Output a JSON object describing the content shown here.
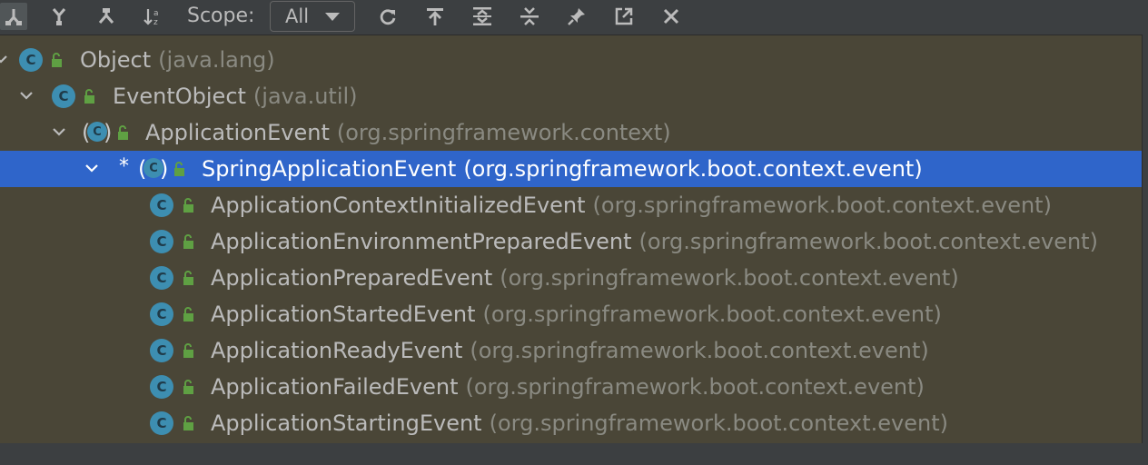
{
  "toolbar": {
    "buttons": [
      {
        "name": "subtypes-hierarchy-button",
        "icon": "subtypes-icon"
      },
      {
        "name": "supertypes-hierarchy-button",
        "icon": "supertypes-icon"
      },
      {
        "name": "class-hierarchy-button",
        "icon": "class-hierarchy-icon"
      },
      {
        "name": "sort-alphabetically-button",
        "icon": "sort-alpha-icon"
      }
    ],
    "scope_label": "Scope:",
    "scope_value": "All",
    "actions": [
      {
        "name": "refresh-button",
        "icon": "refresh-icon"
      },
      {
        "name": "scroll-to-source-button",
        "icon": "scroll-to-source-icon"
      },
      {
        "name": "expand-all-button",
        "icon": "expand-all-icon"
      },
      {
        "name": "collapse-all-button",
        "icon": "collapse-all-icon"
      },
      {
        "name": "pin-button",
        "icon": "pin-icon"
      },
      {
        "name": "open-in-new-window-button",
        "icon": "external-icon"
      },
      {
        "name": "close-button",
        "icon": "close-icon"
      }
    ]
  },
  "colors": {
    "background": "#4a4637",
    "selection": "#2f65ca",
    "class_icon": "#3d8eb1",
    "lock_green": "#5fa043",
    "text": "#bbbbbb",
    "package_text": "#8a8a82"
  },
  "tree": [
    {
      "name": "Object",
      "package": "(java.lang)",
      "expanded": true,
      "abstract": false,
      "selected": false
    },
    {
      "name": "EventObject",
      "package": "(java.util)",
      "expanded": true,
      "abstract": false,
      "selected": false
    },
    {
      "name": "ApplicationEvent",
      "package": "(org.springframework.context)",
      "expanded": true,
      "abstract": true,
      "selected": false
    },
    {
      "name": "SpringApplicationEvent",
      "package": "(org.springframework.boot.context.event)",
      "expanded": true,
      "abstract": true,
      "selected": true,
      "marker": "*"
    },
    {
      "name": "ApplicationContextInitializedEvent",
      "package": "(org.springframework.boot.context.event)",
      "abstract": false,
      "selected": false
    },
    {
      "name": "ApplicationEnvironmentPreparedEvent",
      "package": "(org.springframework.boot.context.event)",
      "abstract": false,
      "selected": false
    },
    {
      "name": "ApplicationPreparedEvent",
      "package": "(org.springframework.boot.context.event)",
      "abstract": false,
      "selected": false
    },
    {
      "name": "ApplicationStartedEvent",
      "package": "(org.springframework.boot.context.event)",
      "abstract": false,
      "selected": false
    },
    {
      "name": "ApplicationReadyEvent",
      "package": "(org.springframework.boot.context.event)",
      "abstract": false,
      "selected": false
    },
    {
      "name": "ApplicationFailedEvent",
      "package": "(org.springframework.boot.context.event)",
      "abstract": false,
      "selected": false
    },
    {
      "name": "ApplicationStartingEvent",
      "package": "(org.springframework.boot.context.event)",
      "abstract": false,
      "selected": false
    }
  ],
  "class_icon_letter": "C"
}
